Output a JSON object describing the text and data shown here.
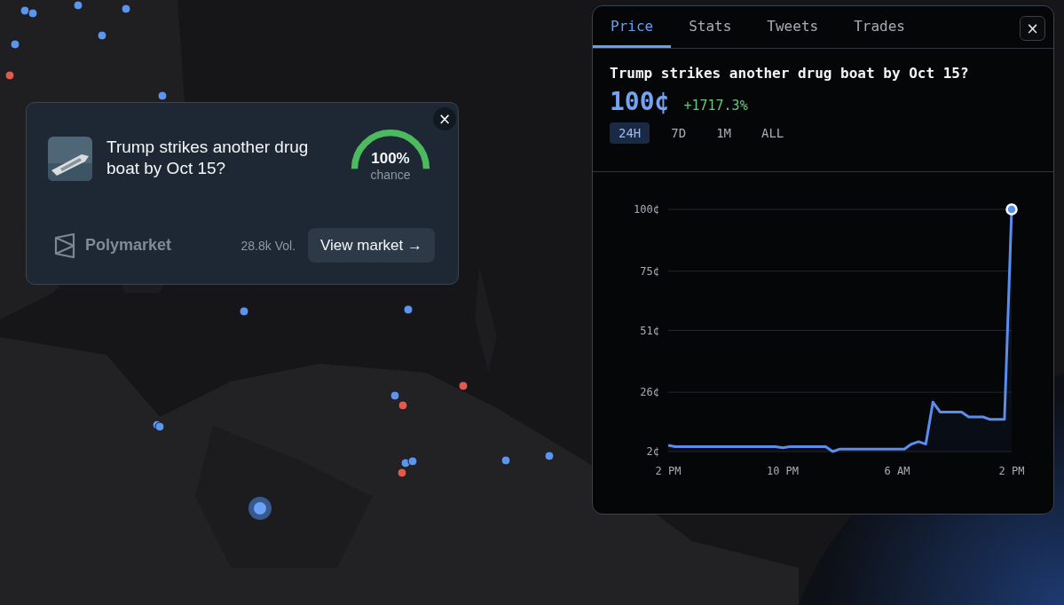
{
  "market_card": {
    "title": "Trump strikes another drug boat by Oct 15?",
    "gauge": {
      "level": 1,
      "value": "100%",
      "caption": "chance"
    },
    "source": "Polymarket",
    "volume": "28.8k Vol.",
    "button": "View market →",
    "close": "×"
  },
  "detail_panel": {
    "tabs": [
      {
        "label": "Price",
        "selected": true
      },
      {
        "label": "Stats",
        "selected": false
      },
      {
        "label": "Tweets",
        "selected": false
      },
      {
        "label": "Trades",
        "selected": false
      }
    ],
    "close": "×",
    "title": "Trump strikes another drug boat by Oct 15?",
    "price": "100¢",
    "change": "+1717.3%",
    "ranges": [
      {
        "label": "24H",
        "selected": true
      },
      {
        "label": "7D",
        "selected": false
      },
      {
        "label": "1M",
        "selected": false
      },
      {
        "label": "ALL",
        "selected": false
      }
    ],
    "chart_data": {
      "type": "area",
      "grid": true,
      "categories": [
        "2 PM",
        null,
        null,
        null,
        null,
        null,
        null,
        null,
        null,
        null,
        null,
        null,
        null,
        null,
        null,
        null,
        "10 PM",
        null,
        null,
        null,
        null,
        null,
        null,
        null,
        null,
        null,
        null,
        null,
        null,
        null,
        null,
        null,
        "6 AM",
        null,
        null,
        null,
        null,
        null,
        null,
        null,
        null,
        null,
        null,
        null,
        null,
        null,
        null,
        null,
        "2 PM"
      ],
      "series": [
        {
          "color": "#5b8def",
          "values": [
            4.5,
            4,
            4,
            4,
            4,
            4,
            4,
            4,
            4,
            4,
            4,
            4,
            4,
            4,
            4,
            4,
            3.5,
            4,
            4,
            4,
            4,
            4,
            4,
            2,
            3,
            3,
            3,
            3,
            3,
            3,
            3,
            3,
            3,
            3,
            5,
            6,
            5,
            22,
            18,
            18,
            18,
            18,
            16,
            16,
            16,
            15,
            15,
            15,
            100
          ]
        }
      ],
      "ylim": [
        2,
        100
      ],
      "yticks": [
        {
          "value": 2,
          "label": "2¢"
        },
        {
          "value": 26,
          "label": "26¢"
        },
        {
          "value": 51,
          "label": "51¢"
        },
        {
          "value": 75,
          "label": "75¢"
        },
        {
          "value": 100,
          "label": "100¢"
        }
      ]
    }
  }
}
